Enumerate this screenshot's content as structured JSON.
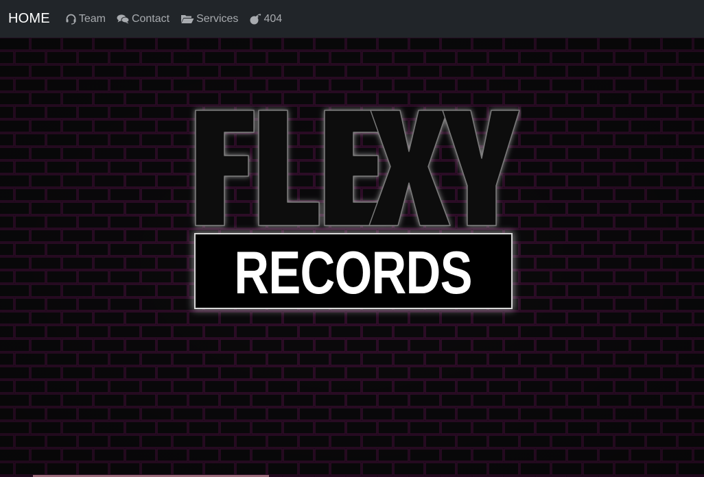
{
  "navbar": {
    "brand": "HOME",
    "links": [
      {
        "label": "Team",
        "icon": "headset-icon"
      },
      {
        "label": "Contact",
        "icon": "comments-icon"
      },
      {
        "label": "Services",
        "icon": "folder-open-icon"
      },
      {
        "label": "404",
        "icon": "bomb-icon"
      }
    ]
  },
  "hero": {
    "logo_top": "FLEXY",
    "logo_bottom": "RECORDS"
  },
  "colors": {
    "navbar_bg": "#212529",
    "nav_text": "#a8abaf",
    "brick_line": "#3a0f32",
    "background": "#050305"
  }
}
